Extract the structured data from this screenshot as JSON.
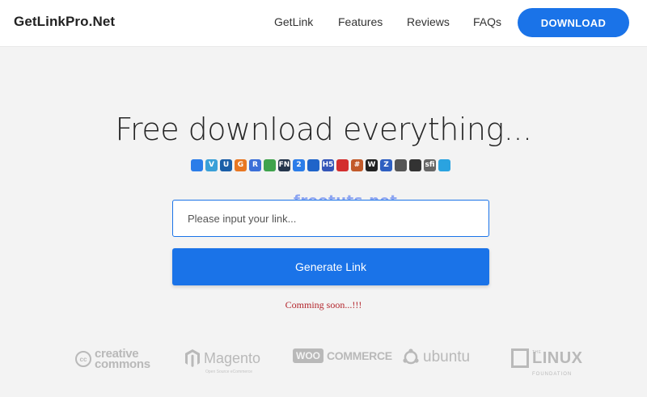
{
  "nav": {
    "brand": "GetLinkPro.Net",
    "links": [
      "GetLink",
      "Features",
      "Reviews",
      "FAQs"
    ],
    "download_label": "DOWNLOAD"
  },
  "hero": {
    "title": "Free download everything...",
    "host_icons": [
      {
        "name": "box-icon",
        "color": "#2b7de9",
        "label": ""
      },
      {
        "name": "vimeo-icon",
        "color": "#3aa0d8",
        "label": "V"
      },
      {
        "name": "uploaded-icon",
        "color": "#1b5fa8",
        "label": "U"
      },
      {
        "name": "g-icon",
        "color": "#e87722",
        "label": "G"
      },
      {
        "name": "rapidgator-icon",
        "color": "#3b6fd8",
        "label": "R"
      },
      {
        "name": "folder-icon",
        "color": "#3fa34d",
        "label": ""
      },
      {
        "name": "fn-icon",
        "color": "#25364d",
        "label": "FN"
      },
      {
        "name": "two-icon",
        "color": "#2b7de9",
        "label": "2"
      },
      {
        "name": "drop-icon",
        "color": "#1f64c9",
        "label": ""
      },
      {
        "name": "h5-icon",
        "color": "#3355b8",
        "label": "H5"
      },
      {
        "name": "cloud-icon",
        "color": "#d32f2f",
        "label": ""
      },
      {
        "name": "grid-icon",
        "color": "#c25a2a",
        "label": "#"
      },
      {
        "name": "w-icon",
        "color": "#222222",
        "label": "W"
      },
      {
        "name": "z-icon",
        "color": "#2e5fc1",
        "label": "Z"
      },
      {
        "name": "card-icon",
        "color": "#555555",
        "label": ""
      },
      {
        "name": "lock-icon",
        "color": "#333333",
        "label": ""
      },
      {
        "name": "sfi-icon",
        "color": "#666666",
        "label": "sfi"
      },
      {
        "name": "eye-icon",
        "color": "#2aa3e0",
        "label": ""
      }
    ]
  },
  "watermark": "freetuts.net",
  "form": {
    "input_placeholder": "Please input your link...",
    "generate_label": "Generate Link",
    "status": "Comming soon...!!!"
  },
  "partners": {
    "cc_top": "creative",
    "cc_bottom": "commons",
    "cc_badge": "cc",
    "magento": "Magento",
    "magento_sub": "Open Source eCommerce",
    "woo_box": "WOO",
    "woo_text": "COMMERCE",
    "ubuntu": "ubuntu",
    "linux_the": "THE",
    "linux": "LINUX",
    "linux_foundation": "FOUNDATION"
  },
  "colors": {
    "accent": "#1a73e8",
    "status": "#b3242b",
    "background": "#f3f3f3"
  }
}
